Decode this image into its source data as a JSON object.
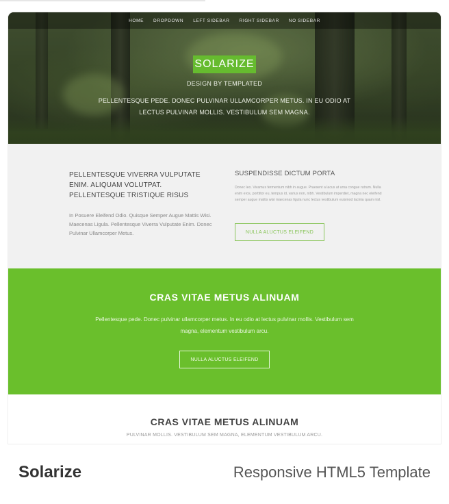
{
  "nav": {
    "items": [
      "HOME",
      "DROPDOWN",
      "LEFT SIDEBAR",
      "RIGHT SIDEBAR",
      "NO SIDEBAR"
    ]
  },
  "hero": {
    "brand": "SOLARIZE",
    "subtitle": "DESIGN BY TEMPLATED",
    "copy": "PELLENTESQUE PEDE. DONEC PULVINAR ULLAMCORPER METUS. IN EU ODIO AT LECTUS PULVINAR MOLLIS. VESTIBULUM SEM MAGNA."
  },
  "features": {
    "left_heading": "PELLENTESQUE VIVERRA VULPUTATE ENIM. ALIQUAM VOLUTPAT. PELLENTESQUE TRISTIQUE RISUS",
    "left_body": "In Posuere Eleifend Odio. Quisque Semper Augue Mattis Wisi. Maecenas Ligula. Pellentesque Viverra Vulputate Enim. Donec Pulvinar Ullamcorper Metus.",
    "right_heading": "SUSPENDISSE DICTUM PORTA",
    "right_body": "Donec leo. Vivamus fermentum nibh in augue. Praesent a lacus at urna congue rutrum. Nulla enim eros, porttitor eu, tempus id, varius non, nibh. Vestibulum imperdiet, magna nec eleifend semper augue mattis wisi maecenas ligula nunc lectus vestibulum euismod lacinia quam nisl.",
    "right_button": "NULLA ALUCTUS ELEIFEND"
  },
  "green": {
    "title": "CRAS VITAE METUS ALINUAM",
    "body": "Pellentesque pede. Donec pulvinar ullamcorper metus. In eu odio at lectus pulvinar mollis. Vestibulum sem magna, elementum vestibulum arcu.",
    "button": "NULLA ALUCTUS ELEIFEND"
  },
  "bottom": {
    "title": "CRAS VITAE METUS ALINUAM",
    "subtitle": "PULVINAR MOLLIS. VESTIBULUM SEM MAGNA, ELEMENTUM VESTIBULUM ARCU."
  },
  "caption": {
    "name": "Solarize",
    "description": "Responsive HTML5 Template"
  },
  "colors": {
    "accent_green": "#6abf2c",
    "brand_box": "#66bb2f",
    "feature_bg": "#f1f1f1",
    "outline_button": "#89c55a"
  }
}
